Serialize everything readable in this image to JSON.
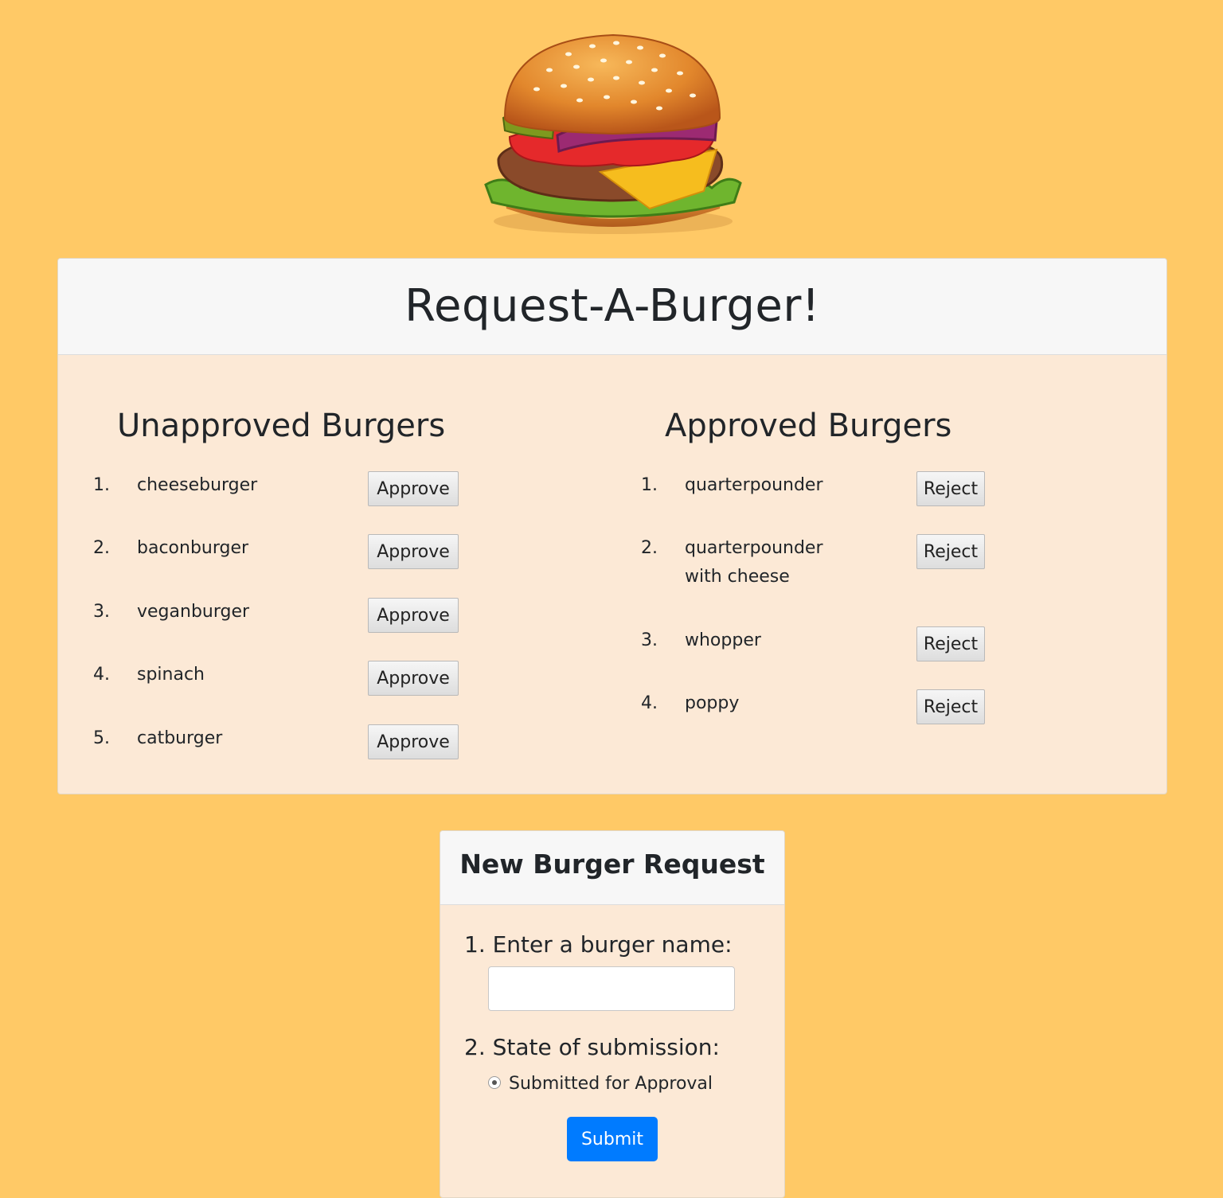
{
  "header": {
    "logo_icon": "hamburger-icon",
    "title": "Request-A-Burger!"
  },
  "colors": {
    "page_background": "#ffc966",
    "card_background": "#fce9d6",
    "card_header_background": "#f7f7f7",
    "submit_button": "#007bff"
  },
  "unapproved": {
    "title": "Unapproved Burgers",
    "button_label": "Approve",
    "items": [
      {
        "number": "1.",
        "name": "cheeseburger"
      },
      {
        "number": "2.",
        "name": "baconburger"
      },
      {
        "number": "3.",
        "name": "veganburger"
      },
      {
        "number": "4.",
        "name": "spinach"
      },
      {
        "number": "5.",
        "name": "catburger"
      }
    ]
  },
  "approved": {
    "title": "Approved Burgers",
    "button_label": "Reject",
    "items": [
      {
        "number": "1.",
        "name": "quarterpounder"
      },
      {
        "number": "2.",
        "name": "quarterpounder with cheese"
      },
      {
        "number": "3.",
        "name": "whopper"
      },
      {
        "number": "4.",
        "name": "poppy"
      }
    ]
  },
  "form": {
    "title": "New Burger Request",
    "name_label": "1. Enter a burger name:",
    "name_value": "",
    "state_label": "2. State of submission:",
    "state_option": "Submitted for Approval",
    "submit_label": "Submit"
  }
}
